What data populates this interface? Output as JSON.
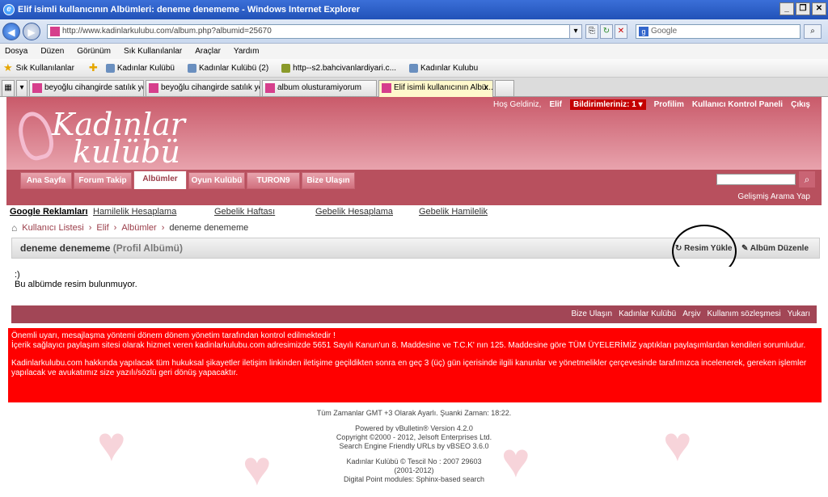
{
  "window": {
    "title": "Elif isimli kullanıcının Albümleri: deneme denememe - Windows Internet Explorer"
  },
  "address": {
    "url": "http://www.kadinlarkulubu.com/album.php?albumid=25670",
    "search_placeholder": "Google"
  },
  "menu": [
    "Dosya",
    "Düzen",
    "Görünüm",
    "Sık Kullanılanlar",
    "Araçlar",
    "Yardım"
  ],
  "favorites": {
    "label": "Sık Kullanılanlar",
    "items": [
      "Kadınlar Kulübü",
      "Kadınlar Kulübü (2)",
      "http--s2.bahcivanlardiyari.c...",
      "Kadınlar Kulubu"
    ]
  },
  "tabs": [
    "beyoğlu cihangirde satılık ye...",
    "beyoğlu cihangirde satılık ye...",
    "album olusturamiyorum",
    "Elif isimli kullanıcının Albü..."
  ],
  "site": {
    "logo_line1": "Kadınlar",
    "logo_line2": "kulübü",
    "greeting": "Hoş Geldiniz,",
    "username": "Elif",
    "notifications": "Bildirimleriniz: 1",
    "profile": "Profilim",
    "panel": "Kullanıcı Kontrol Paneli",
    "logout": "Çıkış",
    "advanced_search": "Gelişmiş Arama Yap"
  },
  "nav": [
    "Ana Sayfa",
    "Forum Takip",
    "Albümler",
    "Oyun Kulübü",
    "TURON9",
    "Bize Ulaşın"
  ],
  "ads": {
    "label": "Google Reklamları",
    "links": [
      "Hamilelik Hesaplama",
      "Gebelik Haftası",
      "Gebelik Hesaplama",
      "Gebelik Hamilelik"
    ]
  },
  "breadcrumb": [
    "Kullanıcı Listesi",
    "Elif",
    "Albümler",
    "deneme denememe"
  ],
  "album": {
    "title": "deneme denememe",
    "subtitle": "(Profil Albümü)",
    "upload": "Resim Yükle",
    "edit": "Albüm Düzenle",
    "smiley": ":)",
    "empty": "Bu albümde resim bulunmuyor."
  },
  "footer_links": [
    "Bize Ulaşın",
    "Kadınlar Kulübü",
    "Arşiv",
    "Kullanım sözleşmesi",
    "Yukarı"
  ],
  "warning": {
    "line1": "Önemli uyarı, mesajlaşma yöntemi dönem dönem yönetim tarafından kontrol edilmektedir !",
    "line2": "İçerik sağlayıcı paylaşım sitesi olarak hizmet veren kadinlarkulubu.com adresimizde 5651 Sayılı Kanun'un 8. Maddesine ve T.C.K' nın 125. Maddesine göre TÜM ÜYELERİMİZ yaptıkları paylaşımlardan kendileri sorumludur.",
    "line3": "Kadinlarkulubu.com hakkında yapılacak tüm hukuksal şikayetler iletişim linkinden iletişime geçildikten sonra en geç 3 (üç) gün içerisinde ilgili kanunlar ve yönetmelikler çerçevesinde tarafımızca incelenerek, gereken işlemler yapılacak ve avukatımız size yazılı/sözlü geri dönüş yapacaktır."
  },
  "bottom": {
    "time": "Tüm Zamanlar GMT +3 Olarak Ayarlı. Şuanki Zaman: 18:22.",
    "powered": "Powered by vBulletin® Version 4.2.0",
    "copyright": "Copyright ©2000 - 2012, Jelsoft Enterprises Ltd.",
    "seo": "Search Engine Friendly URLs by vBSEO 3.6.0",
    "tescil": "Kadınlar Kulübü © Tescil No : 2007 29603",
    "years": "(2001-2012)",
    "modules": "Digital Point modules: Sphinx-based search"
  }
}
